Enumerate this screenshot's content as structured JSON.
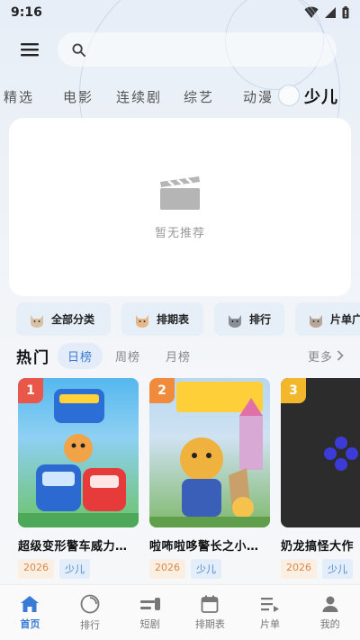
{
  "status_bar": {
    "time": "9:16"
  },
  "search": {
    "placeholder": ""
  },
  "nav_tabs": [
    "精选",
    "电影",
    "连续剧",
    "综艺",
    "动漫",
    "少儿"
  ],
  "empty_state": {
    "text": "暂无推荐"
  },
  "quick_links": [
    "全部分类",
    "排期表",
    "排行",
    "片单广"
  ],
  "hot": {
    "title": "热门",
    "tabs": [
      "日榜",
      "周榜",
      "月榜"
    ],
    "more": "更多"
  },
  "cards": [
    {
      "rank": "1",
      "title": "超级变形警车威力…",
      "year": "2026",
      "genre": "少儿",
      "rank_color": "#e8574a"
    },
    {
      "rank": "2",
      "title": "啦咘啦哆警长之小…",
      "year": "2026",
      "genre": "少儿",
      "rank_color": "#f08a3c"
    },
    {
      "rank": "3",
      "title": "奶龙搞怪大作",
      "year": "2026",
      "genre": "少儿",
      "rank_color": "#f2b72a"
    }
  ],
  "bottom_nav": [
    "首页",
    "排行",
    "短剧",
    "排期表",
    "片单",
    "我的"
  ],
  "colors": {
    "accent": "#3a7bd5"
  }
}
